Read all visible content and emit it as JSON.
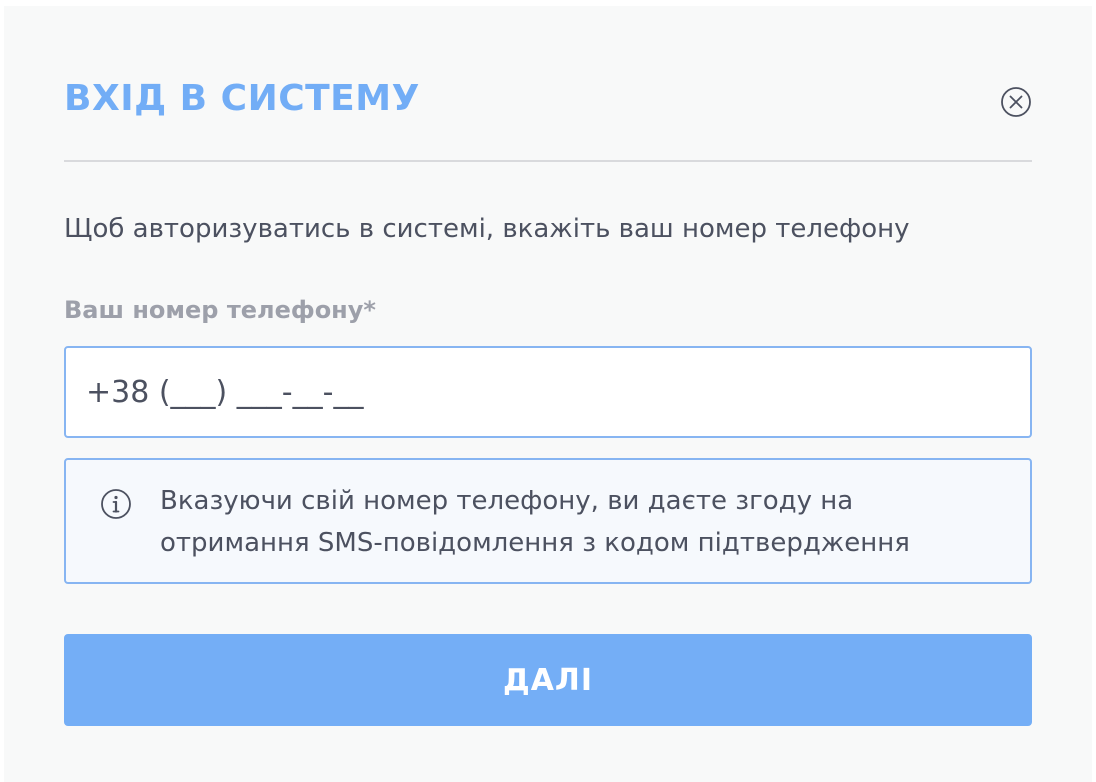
{
  "modal": {
    "title": "ВХІД В СИСТЕМУ",
    "close_icon": "close-circle-icon",
    "intro_text": "Щоб авторизуватись в системі, вкажіть ваш номер телефону",
    "phone_field": {
      "label": "Ваш номер телефону*",
      "value": "",
      "placeholder": "+38 (___) ___-__-__"
    },
    "notice": {
      "icon": "info-circle-icon",
      "text": "Вказуючи свій номер телефону, ви даєте згоду на отримання SMS-повідомлення з кодом підтвердження"
    },
    "next_button_label": "ДАЛІ"
  },
  "colors": {
    "accent": "#72adf6",
    "button": "#74aef6",
    "border": "#87b5f2",
    "text": "#4c5160",
    "label": "#9da0aa",
    "background": "#f8f9f9"
  }
}
